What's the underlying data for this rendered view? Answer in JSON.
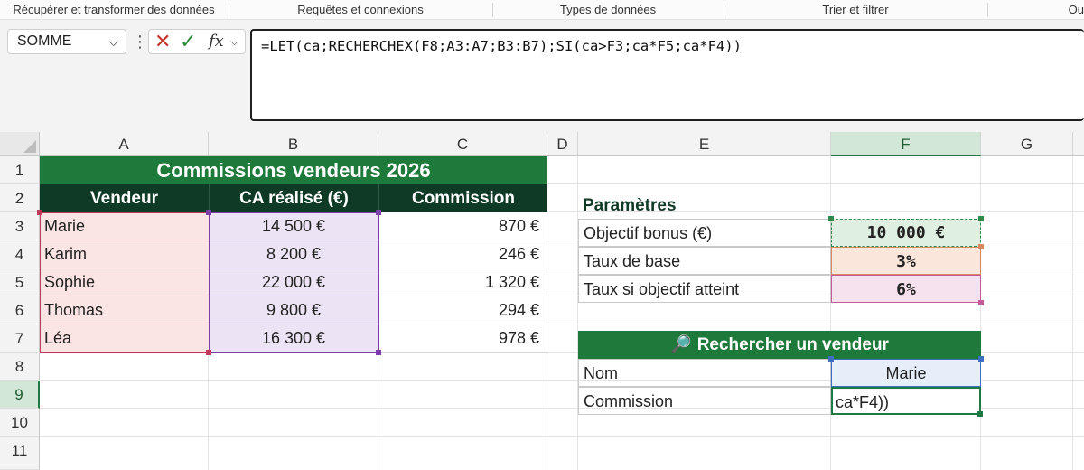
{
  "ribbon": {
    "groups": [
      "Récupérer et transformer des données",
      "Requêtes et connexions",
      "Types de données",
      "Trier et filtrer",
      "Ou"
    ]
  },
  "formula_bar": {
    "name_box": "SOMME",
    "cancel_icon": "✕",
    "enter_icon": "✓",
    "fx_icon": "fx",
    "formula": "=LET(ca;RECHERCHEX(F8;A3:A7;B3:B7);SI(ca>F3;ca*F5;ca*F4))"
  },
  "columns": [
    "A",
    "B",
    "C",
    "D",
    "E",
    "F",
    "G"
  ],
  "selected_column": "F",
  "rows": [
    "1",
    "2",
    "3",
    "4",
    "5",
    "6",
    "7",
    "8",
    "9",
    "10",
    "11"
  ],
  "selected_row": "9",
  "sheet": {
    "title": "Commissions vendeurs 2026",
    "headers": [
      "Vendeur",
      "CA réalisé (€)",
      "Commission"
    ],
    "data": [
      {
        "name": "Marie",
        "ca": "14 500 €",
        "commission": "870 €"
      },
      {
        "name": "Karim",
        "ca": "8 200 €",
        "commission": "246 €"
      },
      {
        "name": "Sophie",
        "ca": "22 000 €",
        "commission": "1 320 €"
      },
      {
        "name": "Thomas",
        "ca": "9 800 €",
        "commission": "294 €"
      },
      {
        "name": "Léa",
        "ca": "16 300 €",
        "commission": "978 €"
      }
    ]
  },
  "params": {
    "title": "Paramètres",
    "rows": [
      {
        "label": "Objectif bonus (€)",
        "value": "10 000 €"
      },
      {
        "label": "Taux de base",
        "value": "3%"
      },
      {
        "label": "Taux si objectif atteint",
        "value": "6%"
      }
    ]
  },
  "lookup": {
    "icon": "🔎",
    "title": "Rechercher un vendeur",
    "name_label": "Nom",
    "name_value": "Marie",
    "commission_label": "Commission",
    "commission_value": "ca*F4))"
  },
  "colors": {
    "header_green": "#1e7a3a",
    "header_dark": "#0f3a26",
    "ref_a3a7": "#c0395a",
    "ref_b3b7": "#7b3fa6",
    "ref_f8": "#3d6fc0",
    "ref_f3": "#2d8a4a"
  }
}
